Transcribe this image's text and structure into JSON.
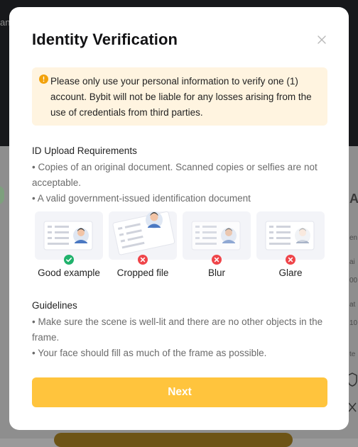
{
  "background": {
    "left_fragment": "an",
    "right_fragments": [
      "A",
      "en",
      "ai",
      "00",
      "at",
      "10",
      "te"
    ]
  },
  "modal": {
    "title": "Identity Verification",
    "notice": "Please only use your personal information to verify one (1) account. Bybit will not be liable for any losses arising from the use of credentials from third parties.",
    "requirements": {
      "title": "ID Upload Requirements",
      "items": [
        "• Copies of an original document. Scanned copies or selfies are not acceptable.",
        "• A valid government-issued identification document"
      ]
    },
    "examples": [
      {
        "label": "Good example",
        "status": "ok"
      },
      {
        "label": "Cropped file",
        "status": "bad"
      },
      {
        "label": "Blur",
        "status": "bad"
      },
      {
        "label": "Glare",
        "status": "bad"
      }
    ],
    "guidelines": {
      "title": "Guidelines",
      "items": [
        "• Make sure the scene is well-lit and there are no other objects in the frame.",
        "• Your face should fill as much of the frame as possible."
      ]
    },
    "next_label": "Next"
  },
  "colors": {
    "accent": "#ffc43d",
    "notice_bg": "#fff4e0",
    "warning_icon": "#f2a20c",
    "ok": "#20b26c",
    "bad": "#ef454a"
  },
  "icons": [
    "close-icon",
    "warning-icon",
    "check-icon",
    "x-icon"
  ]
}
